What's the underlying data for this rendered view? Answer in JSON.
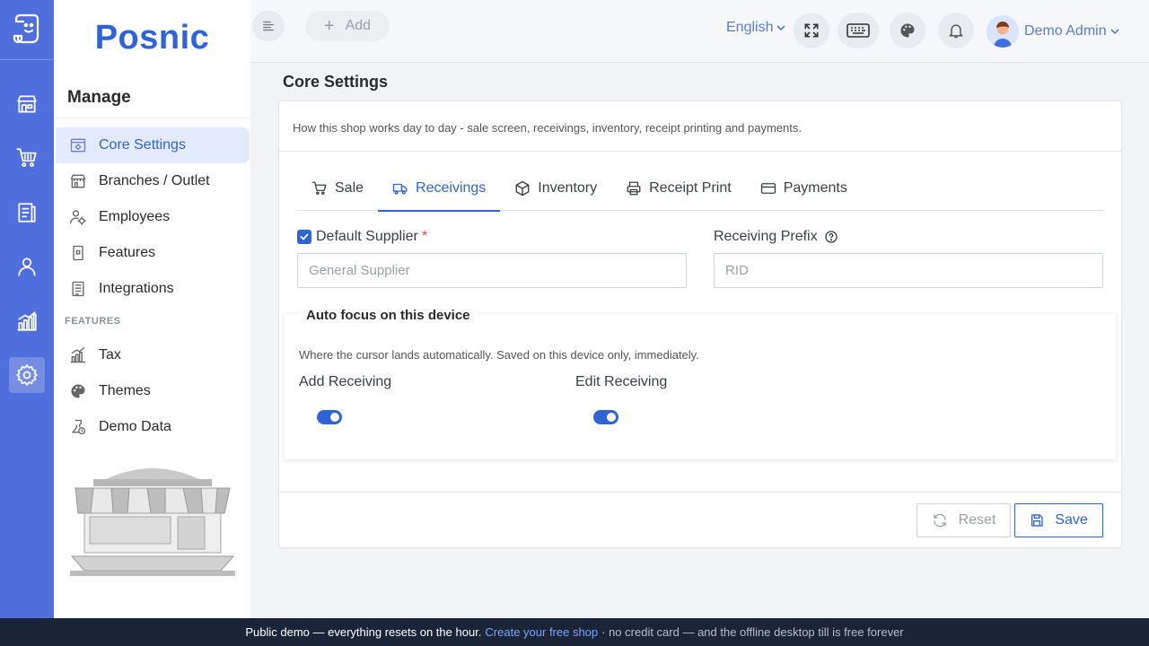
{
  "brand": "Posnic",
  "rail": {
    "items": [
      {
        "icon": "store-icon"
      },
      {
        "icon": "cart-icon"
      },
      {
        "icon": "clipboard-icon"
      },
      {
        "icon": "user-icon"
      },
      {
        "icon": "analytics-icon"
      },
      {
        "icon": "settings-icon",
        "active": true
      }
    ]
  },
  "sidebar": {
    "heading": "Manage",
    "items": [
      {
        "label": "Core Settings",
        "icon": "core-settings-icon",
        "active": true
      },
      {
        "label": "Branches / Outlet",
        "icon": "branches-icon"
      },
      {
        "label": "Employees",
        "icon": "employees-icon"
      },
      {
        "label": "Features",
        "icon": "features-icon"
      },
      {
        "label": "Integrations",
        "icon": "integrations-icon"
      }
    ],
    "section_label": "FEATURES",
    "feature_items": [
      {
        "label": "Tax",
        "icon": "tax-icon"
      },
      {
        "label": "Themes",
        "icon": "palette-icon"
      },
      {
        "label": "Demo Data",
        "icon": "demo-data-icon"
      }
    ]
  },
  "header": {
    "add_label": "Add",
    "language": "English",
    "user_name": "Demo Admin"
  },
  "page": {
    "title": "Core Settings",
    "description": "How this shop works day to day - sale screen, receivings, inventory, receipt printing and payments.",
    "tabs": [
      {
        "label": "Sale",
        "icon": "cart-icon"
      },
      {
        "label": "Receivings",
        "icon": "truck-icon",
        "active": true
      },
      {
        "label": "Inventory",
        "icon": "box-icon"
      },
      {
        "label": "Receipt Print",
        "icon": "printer-icon"
      },
      {
        "label": "Payments",
        "icon": "card-icon"
      }
    ],
    "default_supplier": {
      "label": "Default Supplier",
      "required_mark": "*",
      "checked": true,
      "placeholder": "General Supplier"
    },
    "receiving_prefix": {
      "label": "Receiving Prefix",
      "placeholder": "RID"
    },
    "autofocus": {
      "title": "Auto focus on this device",
      "description": "Where the cursor lands automatically. Saved on this device only, immediately.",
      "add_label": "Add Receiving",
      "add_on": true,
      "edit_label": "Edit Receiving",
      "edit_on": true
    },
    "reset_label": "Reset",
    "save_label": "Save"
  },
  "banner": {
    "text": "Public demo — everything resets on the hour.",
    "link": "Create your free shop",
    "tail": "· no credit card — and the offline desktop till is free forever"
  },
  "colors": {
    "primary": "#2f63d6",
    "rail": "#4f6fdc",
    "banner": "#1c2438"
  }
}
